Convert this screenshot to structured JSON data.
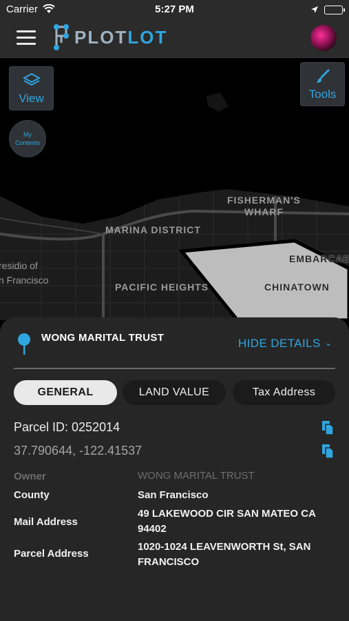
{
  "status_bar": {
    "carrier": "Carrier",
    "time": "5:27 PM"
  },
  "app": {
    "logo_plot": "PLOT",
    "logo_lot": "LOT"
  },
  "map": {
    "view_label": "View",
    "tools_label": "Tools",
    "contents_label": "My Contents",
    "labels": {
      "fishermans": "FISHERMAN'S",
      "wharf": "WHARF",
      "marina": "MARINA DISTRICT",
      "presidio1": "residio of",
      "presidio2": "n Francisco",
      "pacific": "PACIFIC HEIGHTS",
      "chinatown": "CHINATOWN",
      "embarcadero": "EMBARCAD"
    }
  },
  "details": {
    "owner_name": "WONG MARITAL TRUST",
    "hide_label": "HIDE DETAILS",
    "tabs": [
      "GENERAL",
      "LAND VALUE",
      "Tax Address"
    ],
    "parcel_id": "Parcel ID: 0252014",
    "coordinates": "37.790644, -122.41537",
    "fields": [
      {
        "label": "Owner",
        "value": "WONG MARITAL TRUST"
      },
      {
        "label": "County",
        "value": "San Francisco"
      },
      {
        "label": "Mail Address",
        "value": "49  LAKEWOOD CIR SAN MATEO CA 94402"
      },
      {
        "label": "Parcel Address",
        "value": "1020-1024 LEAVENWORTH St, SAN FRANCISCO"
      }
    ]
  },
  "colors": {
    "accent": "#2fa6e0",
    "panel": "#262626",
    "header": "#2b2b2b"
  }
}
